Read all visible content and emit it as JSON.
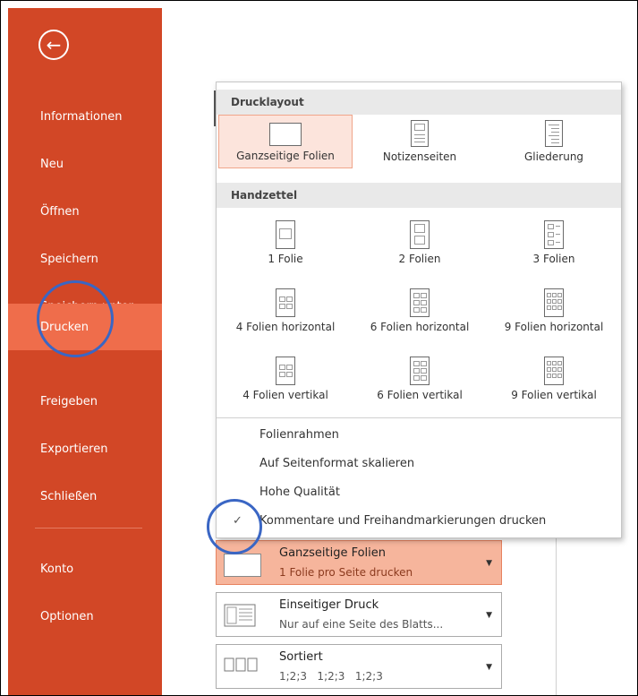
{
  "sidebar": {
    "back_icon": "back-arrow-icon",
    "items": [
      {
        "label": "Informationen"
      },
      {
        "label": "Neu"
      },
      {
        "label": "Öffnen"
      },
      {
        "label": "Speichern"
      },
      {
        "label": "Speichern unter"
      },
      {
        "label": "Drucken",
        "active": true
      },
      {
        "label": "Freigeben"
      },
      {
        "label": "Exportieren"
      },
      {
        "label": "Schließen"
      },
      {
        "label": "Konto"
      },
      {
        "label": "Optionen"
      }
    ]
  },
  "popup": {
    "section1": {
      "header": "Drucklayout",
      "items": [
        {
          "label": "Ganzseitige Folien",
          "selected": true
        },
        {
          "label": "Notizenseiten"
        },
        {
          "label": "Gliederung"
        }
      ]
    },
    "section2": {
      "header": "Handzettel",
      "items": [
        {
          "label": "1 Folie"
        },
        {
          "label": "2 Folien"
        },
        {
          "label": "3 Folien"
        },
        {
          "label": "4 Folien horizontal"
        },
        {
          "label": "6 Folien horizontal"
        },
        {
          "label": "9 Folien horizontal"
        },
        {
          "label": "4 Folien vertikal"
        },
        {
          "label": "6 Folien vertikal"
        },
        {
          "label": "9 Folien vertikal"
        }
      ]
    },
    "options": [
      {
        "label": "Folienrahmen",
        "checked": false
      },
      {
        "label": "Auf Seitenformat skalieren",
        "checked": false
      },
      {
        "label": "Hohe Qualität",
        "checked": false
      },
      {
        "label": "Kommentare und Freihandmarkierungen drucken",
        "checked": true
      }
    ],
    "check_glyph": "✓"
  },
  "settings": [
    {
      "title": "Ganzseitige Folien",
      "sub": "1 Folie pro Seite drucken",
      "selected": true
    },
    {
      "title": "Einseitiger Druck",
      "sub": "Nur auf eine Seite des Blatts..."
    },
    {
      "title": "Sortiert",
      "sub": "1;2;3   1;2;3   1;2;3"
    }
  ],
  "colors": {
    "sidebar": "#d24726",
    "sidebar_active": "#ef6d4b",
    "annotation": "#3a66c4"
  }
}
